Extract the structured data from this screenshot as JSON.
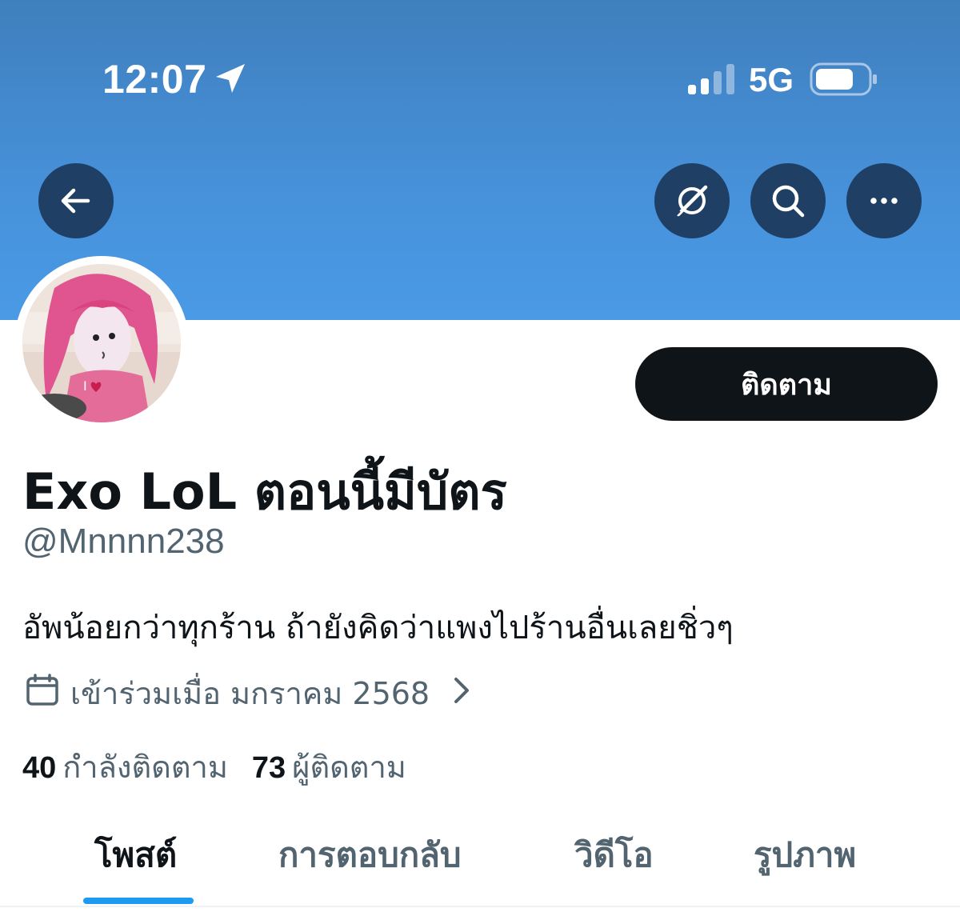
{
  "status_bar": {
    "time": "12:07",
    "network": "5G",
    "location_icon": "location-arrow-icon",
    "signal_icon": "cellular-signal-icon",
    "battery_icon": "battery-icon"
  },
  "header": {
    "back_icon": "arrow-left-icon",
    "grok_icon": "grok-icon",
    "search_icon": "search-icon",
    "more_icon": "more-dots-icon"
  },
  "profile": {
    "display_name": "Exo LoL ตอนนี้มีบัตร",
    "handle": "@Mnnnn238",
    "bio": "อัพน้อยกว่าทุกร้าน ถ้ายังคิดว่าแพงไปร้านอื่นเลยชิ่วๆ",
    "joined": "เข้าร่วมเมื่อ มกราคม 2568",
    "follow_label": "ติดตาม",
    "following_count": "40",
    "following_label": "กำลังติดตาม",
    "followers_count": "73",
    "followers_label": "ผู้ติดตาม"
  },
  "tabs": [
    {
      "label": "โพสต์",
      "active": true
    },
    {
      "label": "การตอบกลับ",
      "active": false
    },
    {
      "label": "วิดีโอ",
      "active": false
    },
    {
      "label": "รูปภาพ",
      "active": false
    }
  ],
  "colors": {
    "banner": "#4690d8",
    "header_button": "#1f3f64",
    "follow_button": "#0f1419",
    "secondary_text": "#536471",
    "tab_indicator": "#1d9bf0"
  }
}
